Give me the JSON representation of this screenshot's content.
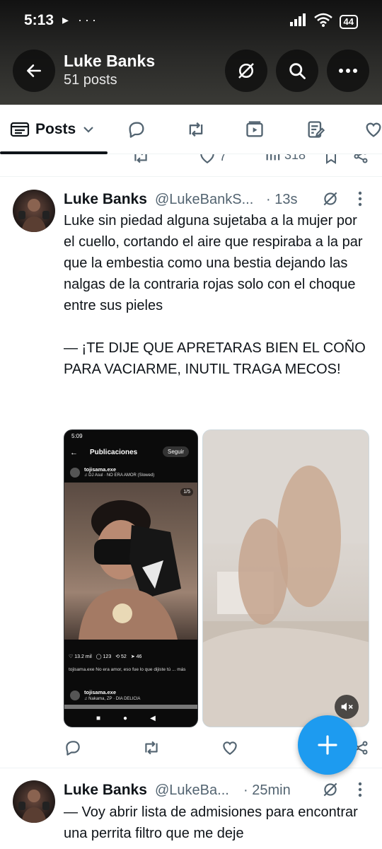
{
  "status_bar": {
    "time": "5:13",
    "left_icons": "▸ ···",
    "battery": "44"
  },
  "header": {
    "title": "Luke Banks",
    "subtitle": "51 posts"
  },
  "tabs": [
    {
      "label": "Posts"
    }
  ],
  "prev_tweet": {
    "retweets": "",
    "likes": "7",
    "views": "318"
  },
  "tweet1": {
    "name": "Luke Banks",
    "handle": "@LukeBankS...",
    "time": "· 13s",
    "text": "Luke sin piedad alguna sujetaba a la mujer por el cuello, cortando el aire que respiraba a la par que la embestia como una bestia dejando las nalgas de la contraria rojas solo con el choque entre sus pieles\n\n— ¡TE DIJE QUE APRETARAS BIEN EL COÑO PARA VACIARME, INUTIL TRAGA MECOS!",
    "media_left": {
      "time": "5:09",
      "header_title": "Publicaciones",
      "follow": "Seguir",
      "username": "tojisama.exe",
      "song": "♫ DJ Asul · NO ERA AMOR (Slowed)",
      "counter": "1/5",
      "likes": "13.2 mil",
      "comments": "123",
      "reposts": "52",
      "shares": "46",
      "caption": "tojisama.exe No era amor, eso fue lo que dijiste tú ... más",
      "username2": "tojisama.exe",
      "song2": "♫ Nakama, ZP · DIA DELICIA"
    }
  },
  "tweet2": {
    "name": "Luke Banks",
    "handle": "@LukeBa...",
    "time": "· 25min",
    "text": "— Voy abrir lista de admisiones para encontrar una perrita filtro que me deje"
  }
}
